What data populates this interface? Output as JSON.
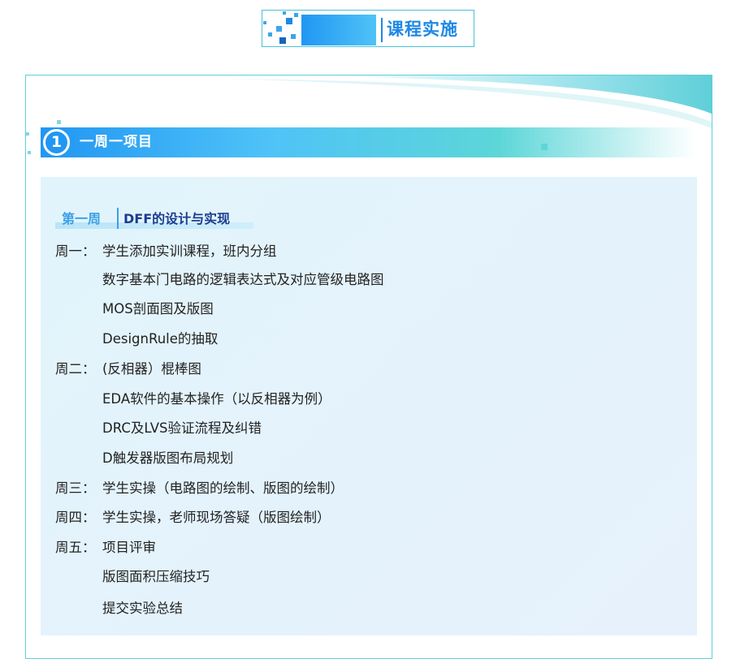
{
  "header": {
    "title": "课程实施"
  },
  "section": {
    "number": "1",
    "title": "一周一项目"
  },
  "week": {
    "label": "第一周",
    "title": "DFF的设计与实现"
  },
  "schedule": [
    {
      "day": "周一：",
      "text": "学生添加实训课程，班内分组"
    },
    {
      "day": "",
      "text": "数字基本门电路的逻辑表达式及对应管级电路图"
    },
    {
      "day": "",
      "text": "MOS剖面图及版图"
    },
    {
      "day": "",
      "text": "DesignRule的抽取"
    },
    {
      "day": "周二：",
      "text": "(反相器）棍棒图"
    },
    {
      "day": "",
      "text": "EDA软件的基本操作（以反相器为例）"
    },
    {
      "day": "",
      "text": "DRC及LVS验证流程及纠错"
    },
    {
      "day": "",
      "text": "D触发器版图布局规划"
    },
    {
      "day": "周三：",
      "text": "学生实操（电路图的绘制、版图的绘制）"
    },
    {
      "day": "周四：",
      "text": "学生实操，老师现场答疑（版图绘制）"
    },
    {
      "day": "周五：",
      "text": "项目评审"
    },
    {
      "day": "",
      "text": "版图面积压缩技巧"
    },
    {
      "day": "",
      "text": "提交实验总结"
    }
  ],
  "colors": {
    "accent": "#1e88e5",
    "teal": "#5dd6d8",
    "panel": "#e2f4fb"
  }
}
